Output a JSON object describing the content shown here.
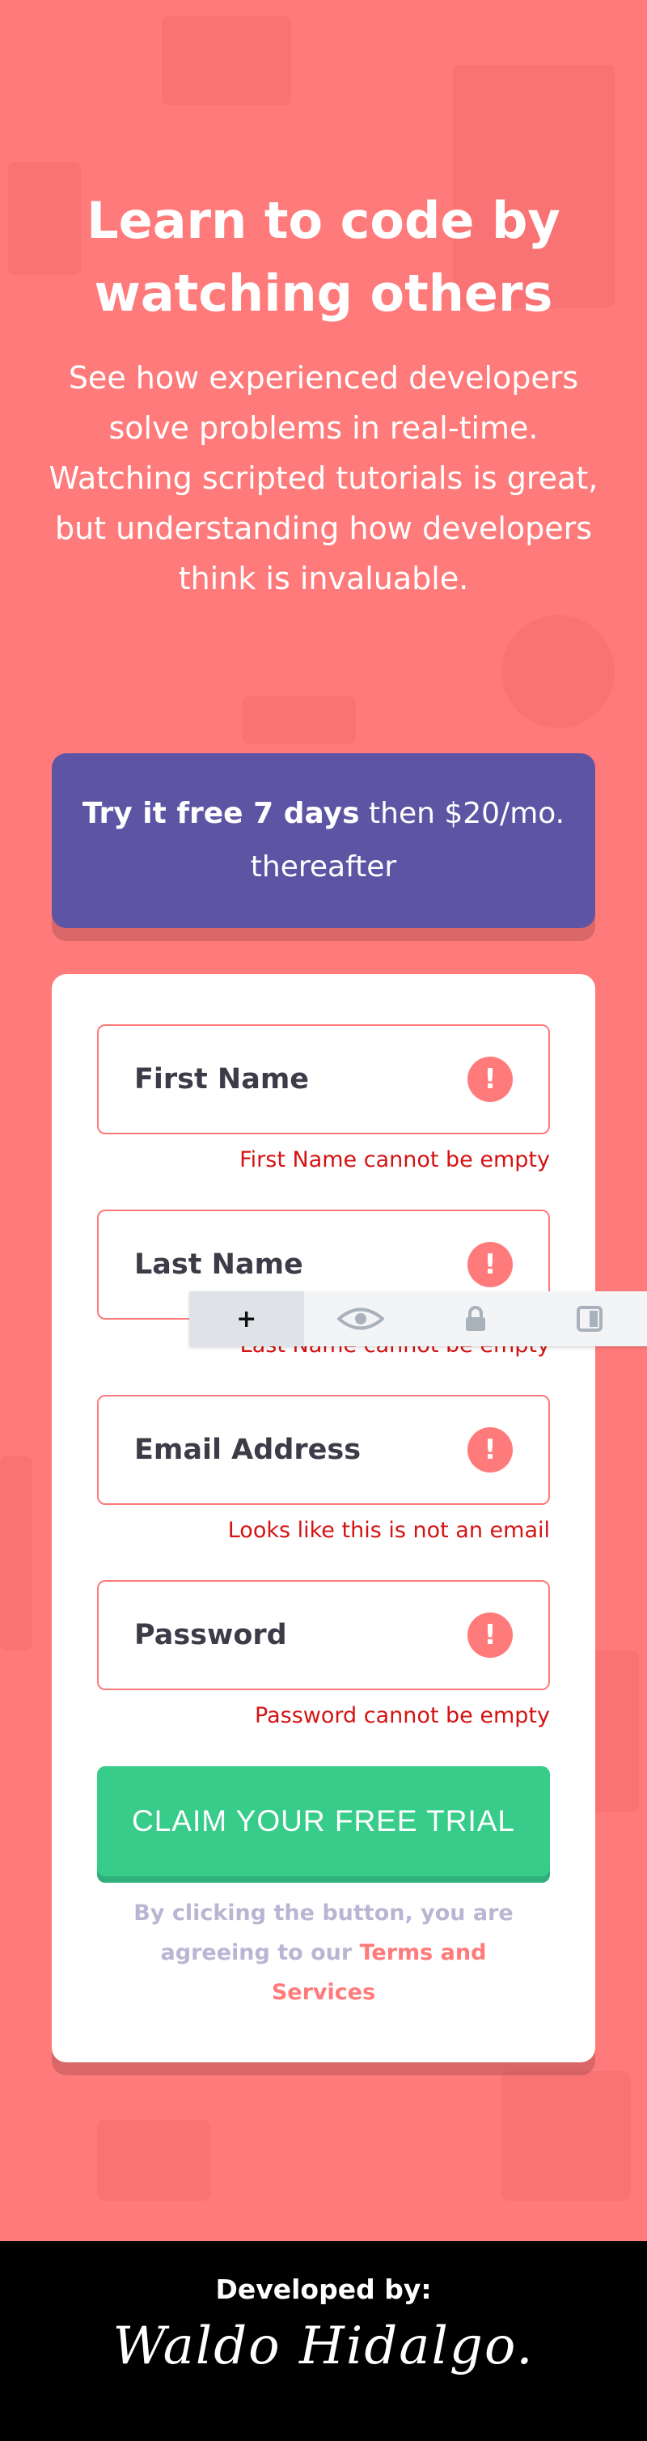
{
  "hero": {
    "title": "Learn to code by watching others",
    "description": "See how experienced developers solve problems in real-time. Watching scripted tutorials is great, but understanding how developers think is invaluable."
  },
  "promo": {
    "bold": "Try it free 7 days",
    "rest": " then $20/mo. thereafter"
  },
  "form": {
    "fields": [
      {
        "label": "First Name",
        "error": "First Name cannot be empty"
      },
      {
        "label": "Last Name",
        "error": "Last Name cannot be empty"
      },
      {
        "label": "Email Address",
        "error": "Looks like this is not an email"
      },
      {
        "label": "Password",
        "error": "Password cannot be empty"
      }
    ],
    "error_icon": "!",
    "submit_label": "CLAIM YOUR FREE TRIAL",
    "terms_prefix": "By clicking the button, you are agreeing to our ",
    "terms_link": "Terms and Services"
  },
  "toolbar": {
    "items": [
      {
        "icon": "plus-icon",
        "glyph": "+"
      },
      {
        "icon": "eye-icon",
        "glyph": "👁"
      },
      {
        "icon": "lock-icon",
        "glyph": "🔒"
      },
      {
        "icon": "contrast-icon",
        "glyph": "◧"
      }
    ]
  },
  "footer": {
    "developed_by": "Developed by:",
    "signature": "Waldo Hidalgo."
  },
  "colors": {
    "background": "#ff7a7a",
    "promo": "#5e54a4",
    "cta": "#38cc8b",
    "error": "#ff7a7a"
  }
}
